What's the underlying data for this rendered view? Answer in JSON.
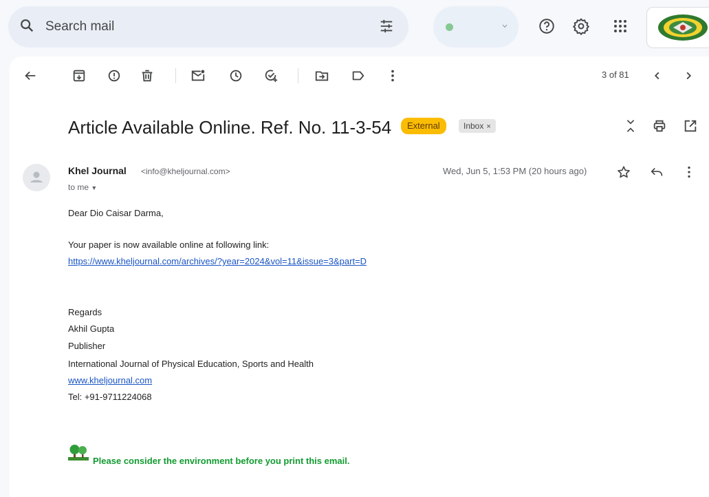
{
  "search": {
    "placeholder": "Search mail"
  },
  "pager": {
    "text": "3 of 81"
  },
  "email": {
    "subject": "Article Available Online. Ref. No. 11-3-54",
    "labels": {
      "external": "External",
      "inbox": "Inbox",
      "inbox_remove": "×"
    },
    "sender_name": "Khel Journal",
    "sender_email": "<info@kheljournal.com>",
    "recipient": "to me",
    "date": "Wed, Jun 5, 1:53 PM (20 hours ago)",
    "body": {
      "greeting": "Dear Dio Caisar Darma,",
      "line1": "Your paper is now available online at following link:",
      "link": "https://www.kheljournal.com/archives/?year=2024&vol=11&issue=3&part=D",
      "regards": "Regards",
      "name": "Akhil Gupta",
      "role": "Publisher",
      "org": "International Journal of Physical Education, Sports and Health",
      "website": "www.kheljournal.com",
      "tel": "Tel: +91-9711224068",
      "footer": "Please consider the environment before you print this email."
    }
  },
  "colors": {
    "external_badge": "#fbbc04",
    "link": "#1a55c4",
    "footer_green": "#129b31"
  }
}
